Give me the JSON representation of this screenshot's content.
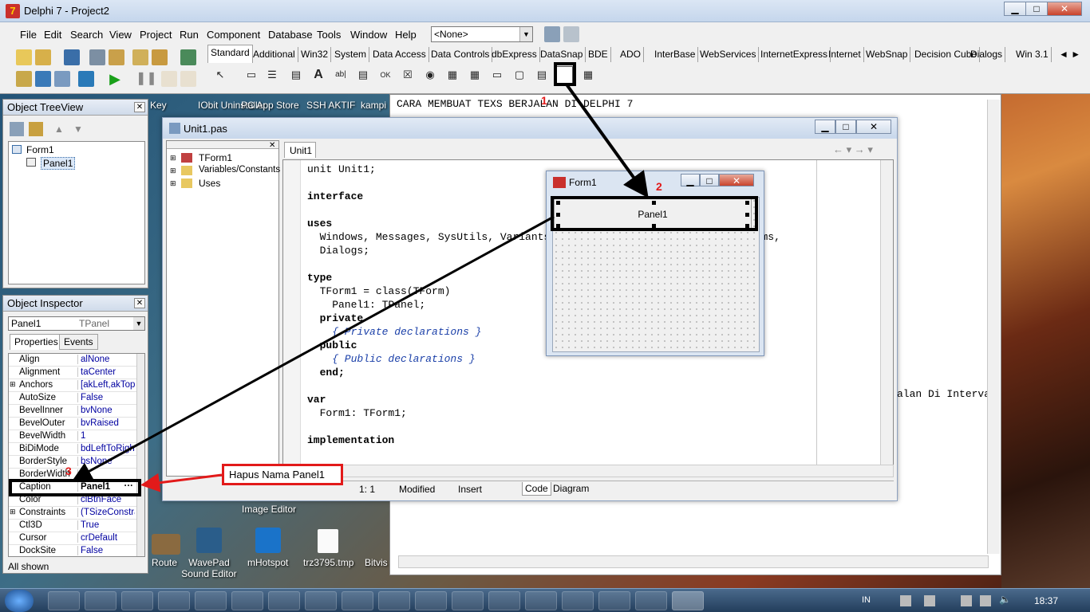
{
  "window": {
    "title": "Delphi 7 - Project2",
    "min": "▁",
    "max": "□",
    "close": "✕"
  },
  "menu": [
    "File",
    "Edit",
    "Search",
    "View",
    "Project",
    "Run",
    "Component",
    "Database",
    "Tools",
    "Window",
    "Help"
  ],
  "desktop_combo": "<None>",
  "palette_tabs": [
    "Standard",
    "Additional",
    "Win32",
    "System",
    "Data Access",
    "Data Controls",
    "dbExpress",
    "DataSnap",
    "BDE",
    "ADO",
    "InterBase",
    "WebServices",
    "InternetExpress",
    "Internet",
    "WebSnap",
    "Decision Cube",
    "Dialogs",
    "Win 3.1"
  ],
  "treeview": {
    "title": "Object TreeView",
    "items": [
      "Form1",
      "Panel1"
    ]
  },
  "inspector": {
    "title": "Object Inspector",
    "object": "Panel1",
    "object_type": "TPanel",
    "tabs": [
      "Properties",
      "Events"
    ],
    "props": [
      {
        "name": "Align",
        "value": "alNone"
      },
      {
        "name": "Alignment",
        "value": "taCenter"
      },
      {
        "name": "Anchors",
        "value": "[akLeft,akTop"
      },
      {
        "name": "AutoSize",
        "value": "False"
      },
      {
        "name": "BevelInner",
        "value": "bvNone"
      },
      {
        "name": "BevelOuter",
        "value": "bvRaised"
      },
      {
        "name": "BevelWidth",
        "value": "1"
      },
      {
        "name": "BiDiMode",
        "value": "bdLeftToRigh"
      },
      {
        "name": "BorderStyle",
        "value": "bsNone"
      },
      {
        "name": "BorderWidth",
        "value": "0"
      },
      {
        "name": "Caption",
        "value": "Panel1"
      },
      {
        "name": "Color",
        "value": "clBtnFace"
      },
      {
        "name": "Constraints",
        "value": "(TSizeConstra"
      },
      {
        "name": "Ctl3D",
        "value": "True"
      },
      {
        "name": "Cursor",
        "value": "crDefault"
      },
      {
        "name": "DockSite",
        "value": "False"
      }
    ],
    "status": "All shown"
  },
  "desktop_icons": [
    "Key",
    "IObit Uninstaller",
    "PC App Store",
    "SSH AKTIF",
    "kampi",
    "Image Editor",
    "Route",
    "WavePad Sound Editor",
    "mHotspot",
    "trz3795.tmp",
    "Bitvis Cli"
  ],
  "unit": {
    "title": "Unit1.pas",
    "tab": "Unit1",
    "explorer": [
      "TForm1",
      "Variables/Constants",
      "Uses"
    ],
    "code": [
      {
        "t": "unit Unit1;",
        "k": "n"
      },
      {
        "t": "",
        "k": "n"
      },
      {
        "t": "interface",
        "k": "b"
      },
      {
        "t": "",
        "k": "n"
      },
      {
        "t": "uses",
        "k": "b"
      },
      {
        "t": "  Windows, Messages, SysUtils, Variants, Classes, Graphics, Controls, Forms,",
        "k": "n"
      },
      {
        "t": "  Dialogs;",
        "k": "n"
      },
      {
        "t": "",
        "k": "n"
      },
      {
        "t": "type",
        "k": "b"
      },
      {
        "t": "  TForm1 = class(TForm)",
        "k": "n"
      },
      {
        "t": "    Panel1: TPanel;",
        "k": "n"
      },
      {
        "t": "  private",
        "k": "b"
      },
      {
        "t": "    { Private declarations }",
        "k": "c"
      },
      {
        "t": "  public",
        "k": "b"
      },
      {
        "t": "    { Public declarations }",
        "k": "c"
      },
      {
        "t": "  end;",
        "k": "b"
      },
      {
        "t": "",
        "k": "n"
      },
      {
        "t": "var",
        "k": "b"
      },
      {
        "t": "  Form1: TForm1;",
        "k": "n"
      },
      {
        "t": "",
        "k": "n"
      },
      {
        "t": "implementation",
        "k": "b"
      }
    ],
    "status": {
      "pos": "1:  1",
      "state": "Modified",
      "mode": "Insert",
      "tab_code": "Code",
      "tab_diagram": "Diagram"
    }
  },
  "back_editor": {
    "heading": "CARA MEMBUAT TEXS BERJALAN DI DELPHI 7",
    "side_text": "alan Di Interva"
  },
  "form1": {
    "title": "Form1",
    "panel_caption": "Panel1"
  },
  "annotations": {
    "n1": "1",
    "n2": "2",
    "n3": "3",
    "callout": "Hapus Nama Panel1"
  },
  "taskbar": {
    "lang": "IN",
    "time": "18:37"
  }
}
